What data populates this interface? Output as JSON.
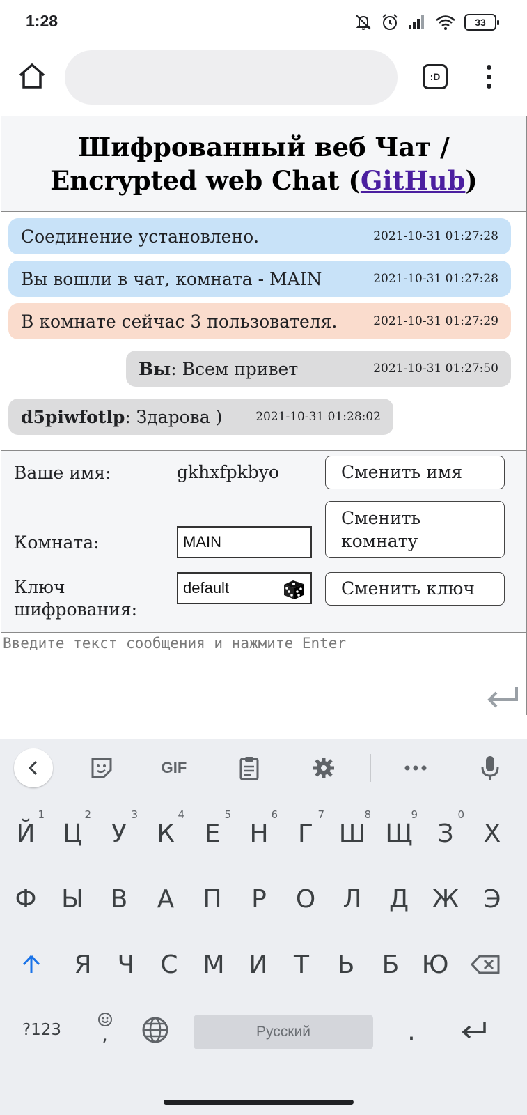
{
  "status_bar": {
    "time": "1:28",
    "battery": "33"
  },
  "browser": {
    "tabs_label": ":D"
  },
  "chat": {
    "title_line1": "Шифрованный веб Чат /",
    "title_line2_prefix": "Encrypted web Chat (",
    "github_link": "GitHub",
    "title_line2_suffix": ")",
    "messages": [
      {
        "text": "Соединение установлено.",
        "time": "2021-10-31 01:27:28"
      },
      {
        "text": "Вы вошли в чат, комната - MAIN",
        "time": "2021-10-31 01:27:28"
      },
      {
        "text": "В комнате сейчас 3 пользователя.",
        "time": "2021-10-31 01:27:29"
      },
      {
        "author": "Вы",
        "text": ": Всем привет",
        "time": "2021-10-31 01:27:50"
      },
      {
        "author": "d5piwfotlp",
        "text": ": Здарова )",
        "time": "2021-10-31 01:28:02"
      }
    ],
    "controls": {
      "name_label": "Ваше имя:",
      "name_value": "gkhxfpkbyo",
      "change_name_button": "Сменить имя",
      "room_label": "Комната:",
      "room_value": "MAIN",
      "change_room_button_line1": "Сменить",
      "change_room_button_line2": "комнату",
      "key_label_line1": "Ключ",
      "key_label_line2": "шифрования:",
      "key_value": "default",
      "change_key_button": "Сменить ключ"
    },
    "message_input_placeholder": "Введите текст сообщения и нажмите Enter"
  },
  "keyboard": {
    "toolbar_gif": "GIF",
    "row1": [
      {
        "key": "Й",
        "hint": "1"
      },
      {
        "key": "Ц",
        "hint": "2"
      },
      {
        "key": "У",
        "hint": "3"
      },
      {
        "key": "К",
        "hint": "4"
      },
      {
        "key": "Е",
        "hint": "5"
      },
      {
        "key": "Н",
        "hint": "6"
      },
      {
        "key": "Г",
        "hint": "7"
      },
      {
        "key": "Ш",
        "hint": "8"
      },
      {
        "key": "Щ",
        "hint": "9"
      },
      {
        "key": "З",
        "hint": "0"
      },
      {
        "key": "Х",
        "hint": ""
      }
    ],
    "row2": [
      "Ф",
      "Ы",
      "В",
      "А",
      "П",
      "Р",
      "О",
      "Л",
      "Д",
      "Ж",
      "Э"
    ],
    "row3": [
      "Я",
      "Ч",
      "С",
      "М",
      "И",
      "Т",
      "Ь",
      "Б",
      "Ю"
    ],
    "numbers_key": "?123",
    "comma_key": ",",
    "space_label": "Русский",
    "period_key": "."
  },
  "colors": {
    "system_bubble": "#c8e2f8",
    "info_bubble": "#fadccd",
    "user_bubble": "#dcdcdd",
    "link": "#4b1fa0",
    "shift_accent": "#1a73e8"
  }
}
